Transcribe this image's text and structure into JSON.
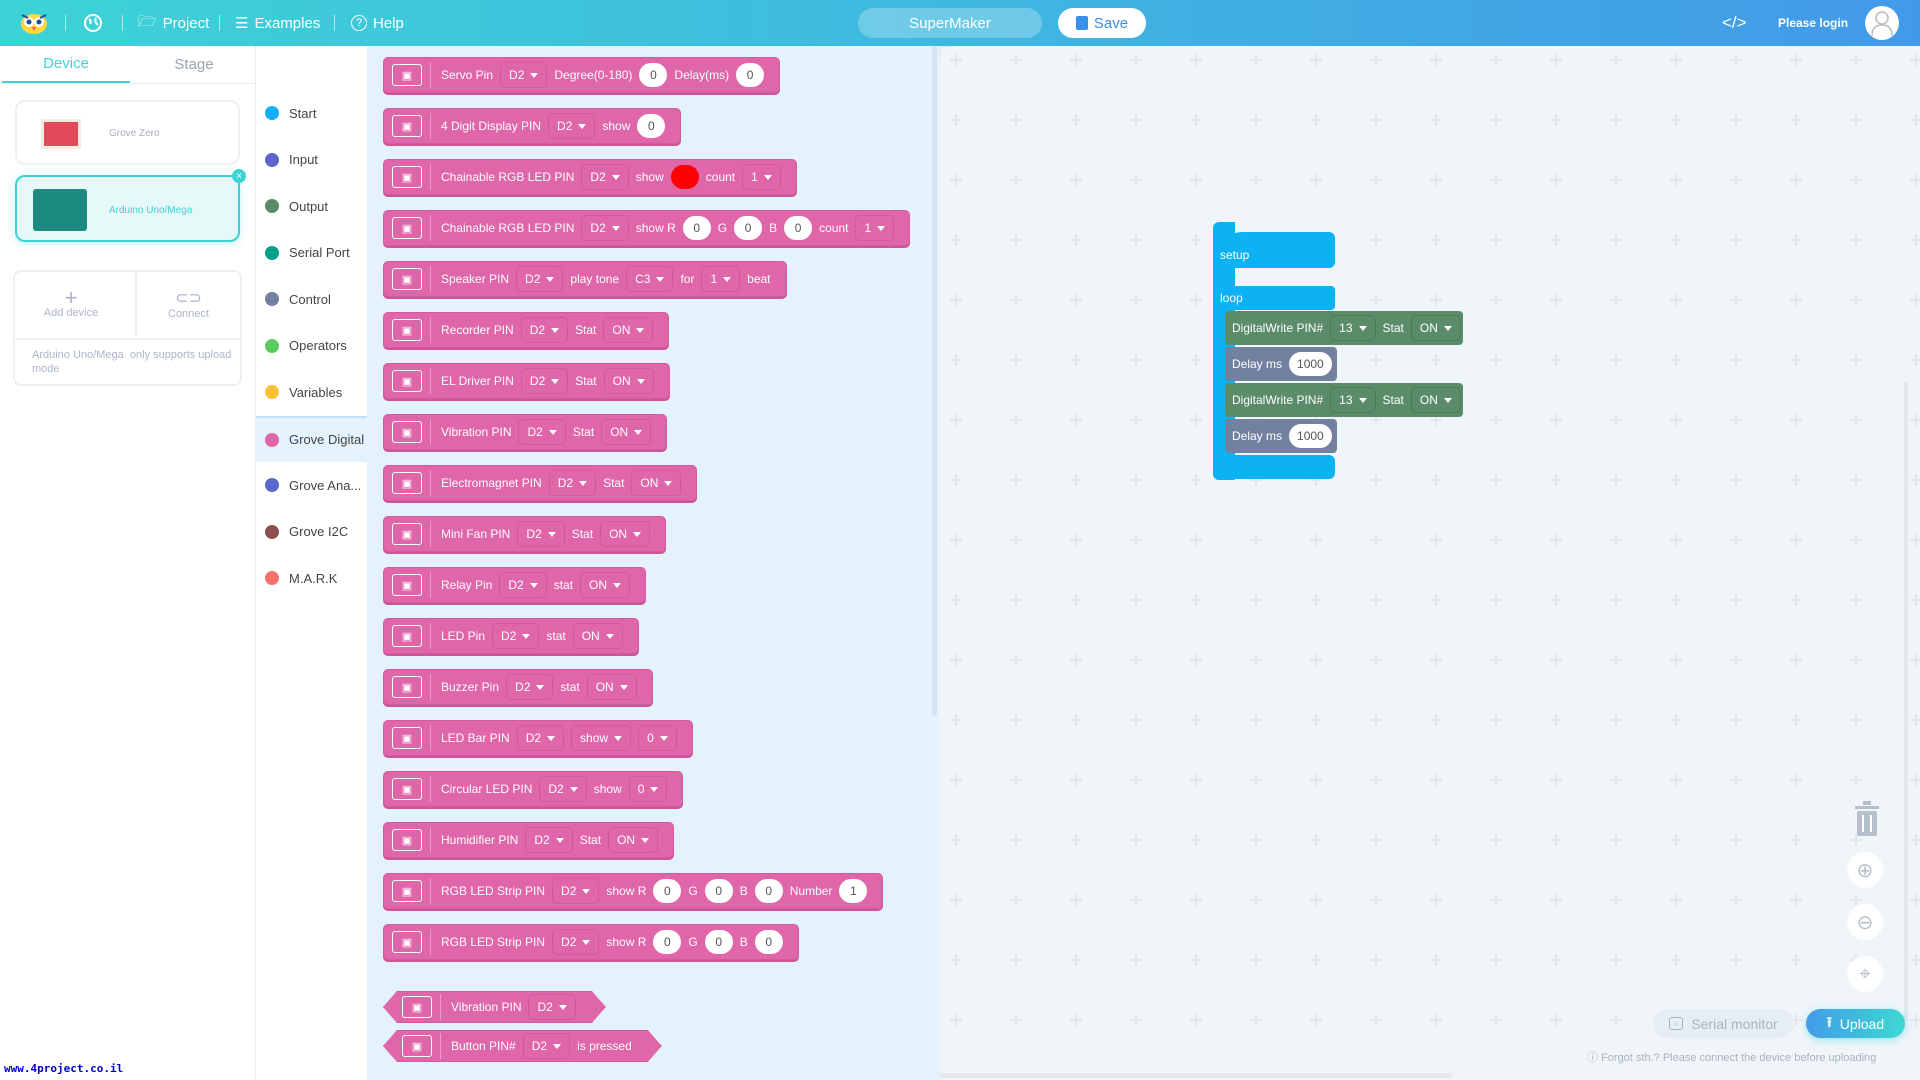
{
  "header": {
    "menu": [
      {
        "label": "Project",
        "icon": "folder-icon"
      },
      {
        "label": "Examples",
        "icon": "examples-icon"
      },
      {
        "label": "Help",
        "icon": "help-icon"
      }
    ],
    "project_name": "SuperMaker",
    "save_label": "Save",
    "login_label": "Please login"
  },
  "left": {
    "tabs": [
      "Device",
      "Stage"
    ],
    "devices": [
      {
        "name": "Grove Zero",
        "selected": false
      },
      {
        "name": "Arduino Uno/Mega",
        "selected": true
      }
    ],
    "add_device": "Add device",
    "connect": "Connect",
    "note": "Arduino Uno/Mega  only supports upload mode"
  },
  "categories": [
    {
      "label": "Start",
      "color": "#0fb0f5"
    },
    {
      "label": "Input",
      "color": "#5b67cc"
    },
    {
      "label": "Output",
      "color": "#5a8c6a"
    },
    {
      "label": "Serial Port",
      "color": "#05a08a"
    },
    {
      "label": "Control",
      "color": "#7281a0"
    },
    {
      "label": "Operators",
      "color": "#5ccb5f"
    },
    {
      "label": "Variables",
      "color": "#fdbf3a"
    },
    {
      "label": "Grove Digital",
      "color": "#e066aa",
      "selected": true
    },
    {
      "label": "Grove Ana...",
      "color": "#5b67cc"
    },
    {
      "label": "Grove I2C",
      "color": "#8a5050"
    },
    {
      "label": "M.A.R.K",
      "color": "#f5716c"
    }
  ],
  "palette": [
    [
      [
        "t",
        "Servo Pin"
      ],
      [
        "d",
        "D2"
      ],
      [
        "t",
        "Degree(0-180)"
      ],
      [
        "n",
        "0"
      ],
      [
        "t",
        "Delay(ms)"
      ],
      [
        "n",
        "0"
      ]
    ],
    [
      [
        "t",
        "4 Digit Display PIN"
      ],
      [
        "d",
        "D2"
      ],
      [
        "t",
        "show"
      ],
      [
        "n",
        "0"
      ]
    ],
    [
      [
        "t",
        "Chainable RGB LED PIN"
      ],
      [
        "d",
        "D2"
      ],
      [
        "t",
        "show"
      ],
      [
        "c",
        "#ff0000"
      ],
      [
        "t",
        "count"
      ],
      [
        "d",
        "1"
      ]
    ],
    [
      [
        "t",
        "Chainable RGB LED PIN"
      ],
      [
        "d",
        "D2"
      ],
      [
        "t",
        "show R"
      ],
      [
        "n",
        "0"
      ],
      [
        "t",
        "G"
      ],
      [
        "n",
        "0"
      ],
      [
        "t",
        "B"
      ],
      [
        "n",
        "0"
      ],
      [
        "t",
        "count"
      ],
      [
        "d",
        "1"
      ]
    ],
    [
      [
        "t",
        "Speaker PIN"
      ],
      [
        "d",
        "D2"
      ],
      [
        "t",
        "play tone"
      ],
      [
        "d",
        "C3"
      ],
      [
        "t",
        "for"
      ],
      [
        "d",
        "1"
      ],
      [
        "t",
        "beat"
      ]
    ],
    [
      [
        "t",
        "Recorder PIN"
      ],
      [
        "d",
        "D2"
      ],
      [
        "t",
        "Stat"
      ],
      [
        "d",
        "ON"
      ]
    ],
    [
      [
        "t",
        "EL Driver PIN"
      ],
      [
        "d",
        "D2"
      ],
      [
        "t",
        "Stat"
      ],
      [
        "d",
        "ON"
      ]
    ],
    [
      [
        "t",
        "Vibration PIN"
      ],
      [
        "d",
        "D2"
      ],
      [
        "t",
        "Stat"
      ],
      [
        "d",
        "ON"
      ]
    ],
    [
      [
        "t",
        "Electromagnet PIN"
      ],
      [
        "d",
        "D2"
      ],
      [
        "t",
        "Stat"
      ],
      [
        "d",
        "ON"
      ]
    ],
    [
      [
        "t",
        "Mini Fan PIN"
      ],
      [
        "d",
        "D2"
      ],
      [
        "t",
        "Stat"
      ],
      [
        "d",
        "ON"
      ]
    ],
    [
      [
        "t",
        "Relay Pin"
      ],
      [
        "d",
        "D2"
      ],
      [
        "t",
        "stat"
      ],
      [
        "d",
        "ON"
      ]
    ],
    [
      [
        "t",
        "LED Pin"
      ],
      [
        "d",
        "D2"
      ],
      [
        "t",
        "stat"
      ],
      [
        "d",
        "ON"
      ]
    ],
    [
      [
        "t",
        "Buzzer Pin"
      ],
      [
        "d",
        "D2"
      ],
      [
        "t",
        "stat"
      ],
      [
        "d",
        "ON"
      ]
    ],
    [
      [
        "t",
        "LED Bar PIN"
      ],
      [
        "d",
        "D2"
      ],
      [
        "d",
        "show"
      ],
      [
        "d",
        "0"
      ]
    ],
    [
      [
        "t",
        "Circular LED PIN"
      ],
      [
        "d",
        "D2"
      ],
      [
        "t",
        "show"
      ],
      [
        "d",
        "0"
      ]
    ],
    [
      [
        "t",
        "Humidifier PIN"
      ],
      [
        "d",
        "D2"
      ],
      [
        "t",
        "Stat"
      ],
      [
        "d",
        "ON"
      ]
    ],
    [
      [
        "t",
        "RGB LED Strip PIN"
      ],
      [
        "d",
        "D2"
      ],
      [
        "t",
        "show R"
      ],
      [
        "n",
        "0"
      ],
      [
        "t",
        "G"
      ],
      [
        "n",
        "0"
      ],
      [
        "t",
        "B"
      ],
      [
        "n",
        "0"
      ],
      [
        "t",
        "Number"
      ],
      [
        "n",
        "1"
      ]
    ],
    [
      [
        "t",
        "RGB LED Strip PIN"
      ],
      [
        "d",
        "D2"
      ],
      [
        "t",
        "show R"
      ],
      [
        "n",
        "0"
      ],
      [
        "t",
        "G"
      ],
      [
        "n",
        "0"
      ],
      [
        "t",
        "B"
      ],
      [
        "n",
        "0"
      ]
    ]
  ],
  "palette_reporters": [
    [
      [
        "t",
        "Vibration PIN"
      ],
      [
        "d",
        "D2"
      ]
    ],
    [
      [
        "t",
        "Button PIN#"
      ],
      [
        "d",
        "D2"
      ],
      [
        "t",
        "is pressed"
      ]
    ]
  ],
  "workspace": {
    "setup": "setup",
    "loop": "loop",
    "blocks": [
      {
        "label": "DigitalWrite PIN#",
        "pin": "13",
        "stat_label": "Stat",
        "stat": "ON"
      },
      {
        "label": "Delay ms",
        "value": "1000"
      },
      {
        "label": "DigitalWrite PIN#",
        "pin": "13",
        "stat_label": "Stat",
        "stat": "ON"
      },
      {
        "label": "Delay ms",
        "value": "1000"
      }
    ]
  },
  "footer": {
    "serial_monitor": "Serial monitor",
    "upload": "Upload",
    "hint": "Forgot sth.? Please connect the device before uploading"
  },
  "watermark": "www.4project.co.il"
}
